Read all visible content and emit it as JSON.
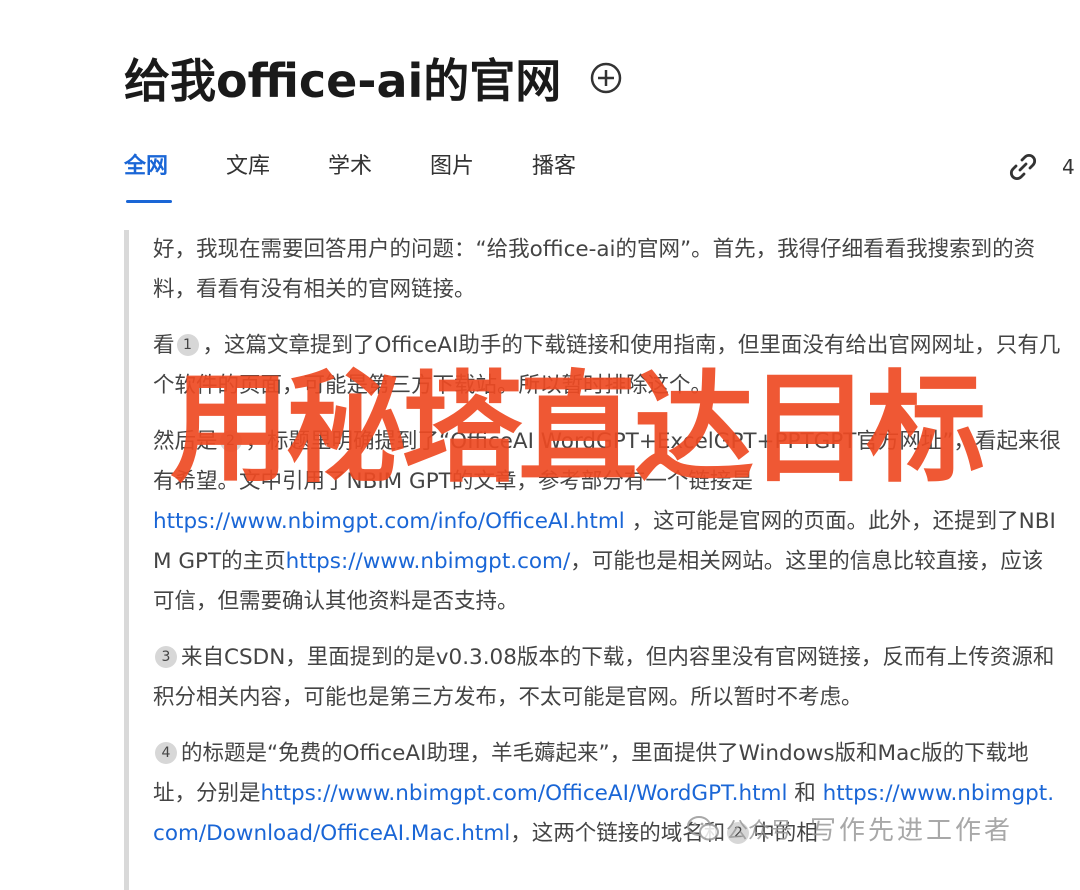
{
  "header": {
    "title": "给我office-ai的官网"
  },
  "tabs": [
    {
      "label": "全网",
      "active": true
    },
    {
      "label": "文库"
    },
    {
      "label": "学术"
    },
    {
      "label": "图片"
    },
    {
      "label": "播客"
    }
  ],
  "share": {
    "count": "4"
  },
  "answer": {
    "p1": "好，我现在需要回答用户的问题：“给我office-ai的官网”。首先，我得仔细看看我搜索到的资料，看看有没有相关的官网链接。",
    "p2_ref": "1",
    "p2_text": "，这篇文章提到了OfficeAI助手的下载链接和使用指南，但里面没有给出官网网址，只有几个软件的页面，可能是第三方下载站。所以暂时排除这个。",
    "p2_lead": "看",
    "p3_lead": "然后是",
    "p3_ref": "2",
    "p3_text": "，标题里明确提到了“OfficeAI WordGPT+ExcelGPT+PPTGPT官方网址”，看起来很有希望。文中引用了NBIM GPT的文章，参考部分有一个链接是",
    "p3_link1": "https://www.nbimgpt.com/info/OfficeAI.html",
    "p3_mid": "，这可能是官网的页面。此外，还提到了NBIM GPT的主页",
    "p3_link2": "https://www.nbimgpt.com/",
    "p3_tail": "，可能也是相关网站。这里的信息比较直接，应该可信，但需要确认其他资料是否支持。",
    "p4_ref": "3",
    "p4_text": "来自CSDN，里面提到的是v0.3.08版本的下载，但内容里没有官网链接，反而有上传资源和积分相关内容，可能也是第三方发布，不太可能是官网。所以暂时不考虑。",
    "p5_ref": "4",
    "p5_text": "的标题是“免费的OfficeAI助理，羊毛薅起来”，里面提供了Windows版和Mac版的下载地址，分别是",
    "p5_link1": "https://www.nbimgpt.com/OfficeAI/WordGPT.html",
    "p5_mid": " 和 ",
    "p5_link2": "https://www.nbimgpt.com/Download/OfficeAI.Mac.html",
    "p5_tail": "，这两个链接的域名和",
    "p5_ref2": "2",
    "p5_end": "中的相"
  },
  "overlay": {
    "text": "用秘塔直达目标"
  },
  "watermark": {
    "source": "公众号",
    "text": "写作先进工作者"
  },
  "colors": {
    "accent": "#1a66d6",
    "overlay": "#ee4a23"
  }
}
